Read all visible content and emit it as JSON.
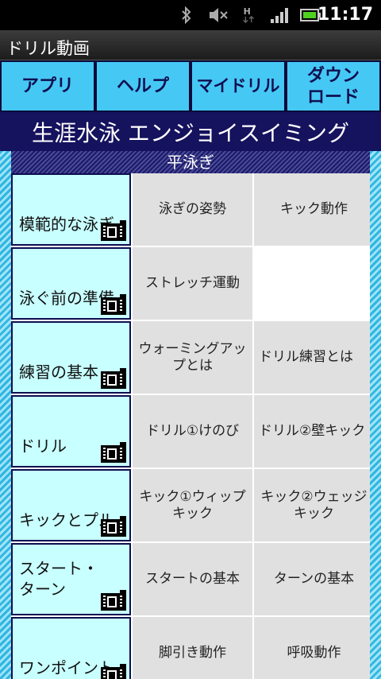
{
  "status": {
    "time": "11:17",
    "icons": [
      "bluetooth-icon",
      "vibrate-icon",
      "data-h-icon",
      "signal-icon",
      "battery-icon"
    ]
  },
  "app": {
    "title": "ドリル動画"
  },
  "tabs": [
    {
      "label": "アプリ"
    },
    {
      "label": "ヘルプ"
    },
    {
      "label": "マイドリル"
    },
    {
      "label": "ダウン\nロード"
    }
  ],
  "banner": {
    "text": "生涯水泳 エンジョイスイミング"
  },
  "section": {
    "title": "平泳ぎ"
  },
  "rows": [
    {
      "category": "模範的な泳ぎ",
      "items": [
        "泳ぎの姿勢",
        "キック動作"
      ]
    },
    {
      "category": "泳ぐ前の準備",
      "items": [
        "ストレッチ運動",
        ""
      ]
    },
    {
      "category": "練習の基本",
      "items": [
        "ウォーミングアップとは",
        "ドリル練習とは"
      ]
    },
    {
      "category": "ドリル",
      "items": [
        "ドリル①けのび",
        "ドリル②壁キック"
      ]
    },
    {
      "category": "キックとプル",
      "items": [
        "キック①ウィップキック",
        "キック②ウェッジキック"
      ]
    },
    {
      "category": "スタート・ターン",
      "items": [
        "スタートの基本",
        "ターンの基本"
      ]
    },
    {
      "category": "ワンポイント",
      "items": [
        "脚引き動作",
        "呼吸動作"
      ]
    }
  ],
  "colors": {
    "tab_bg": "#46c8f5",
    "banner_bg": "#15125e",
    "category_bg": "#c8ffff",
    "item_bg": "#e0e0e0"
  }
}
